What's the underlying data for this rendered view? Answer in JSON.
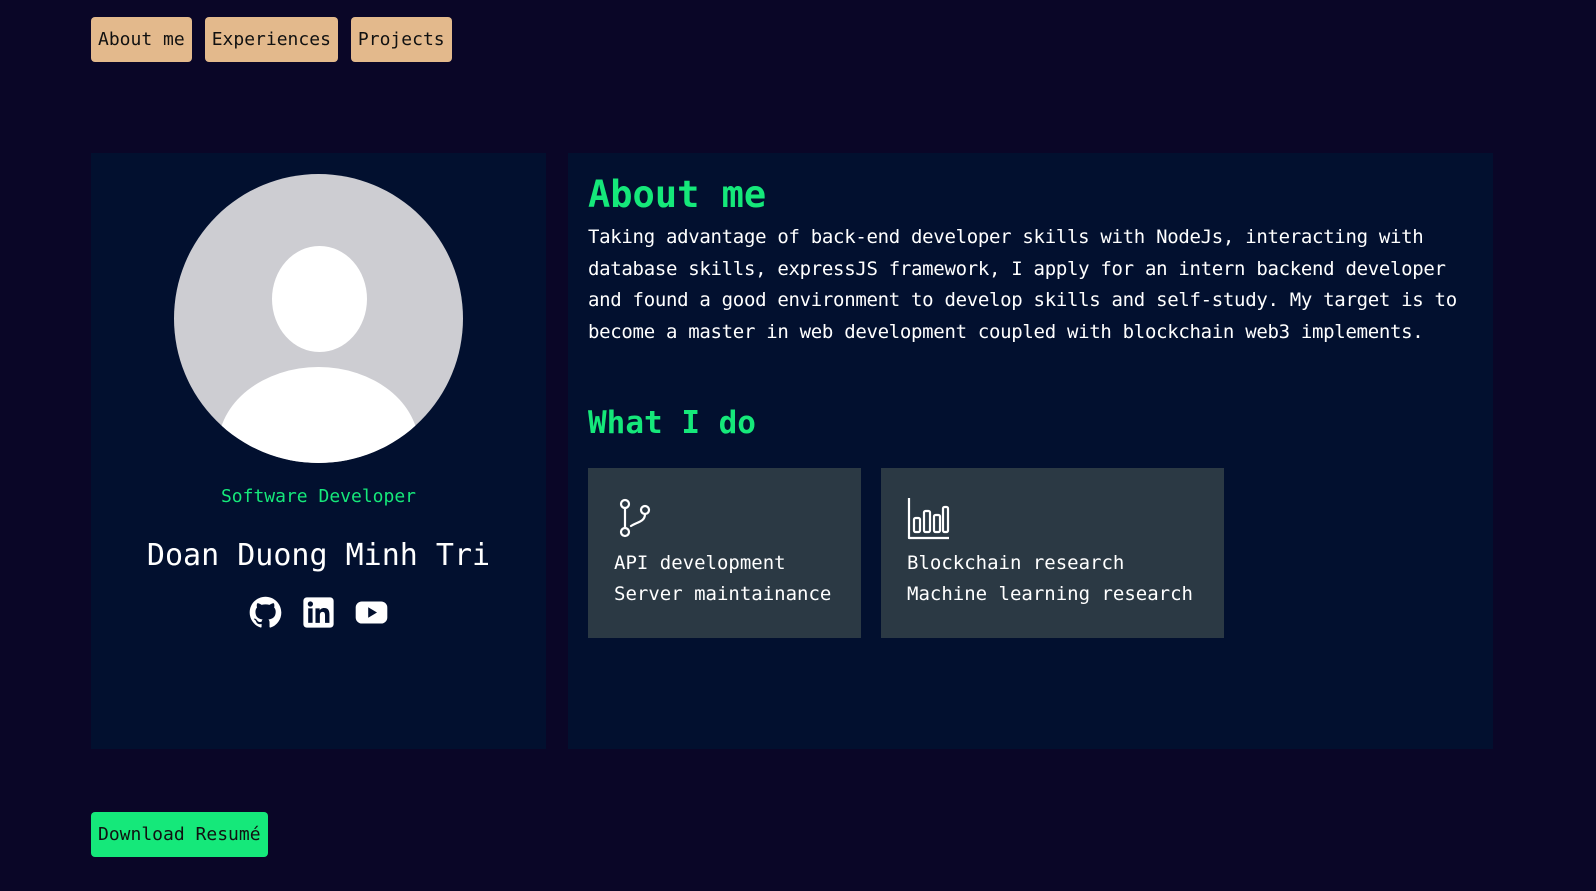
{
  "nav": {
    "items": [
      {
        "label": "About me"
      },
      {
        "label": "Experiences"
      },
      {
        "label": "Projects"
      }
    ]
  },
  "profile": {
    "role": "Software Developer",
    "name": "Doan Duong Minh Tri",
    "socials": [
      {
        "icon": "github-icon"
      },
      {
        "icon": "linkedin-icon"
      },
      {
        "icon": "youtube-icon"
      }
    ]
  },
  "about": {
    "title": "About me",
    "text": "Taking advantage of back-end developer skills with NodeJs, interacting with database skills, expressJS framework, I apply for an intern backend developer and found a good environment to develop skills and self-study. My target is to become a master in web development coupled with blockchain web3 implements.",
    "what_i_do_title": "What I do",
    "services": [
      {
        "icon": "git-branch-icon",
        "lines": [
          "API development",
          "Server maintainance"
        ]
      },
      {
        "icon": "bar-chart-icon",
        "lines": [
          "Blockchain research",
          "Machine learning research"
        ]
      }
    ]
  },
  "download": {
    "label": "Download Resumé"
  },
  "colors": {
    "background": "#0a0627",
    "card": "#02102f",
    "accent_green": "#15e87a",
    "nav_button": "#e3b98c",
    "service_card": "#2b3944"
  }
}
